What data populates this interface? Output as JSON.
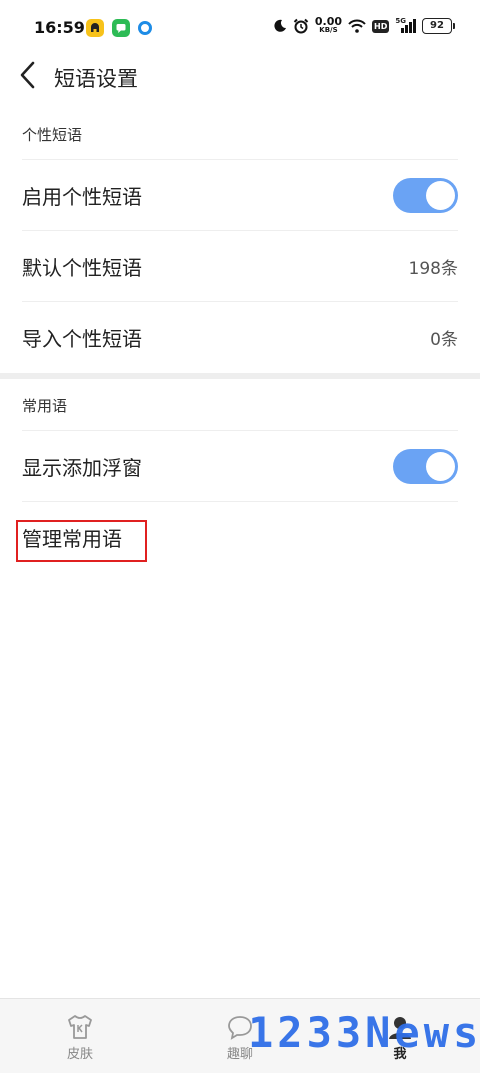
{
  "status_bar": {
    "time": "16:59",
    "net_speed_value": "0.00",
    "net_speed_unit": "KB/S",
    "hd_label": "HD",
    "network_label": "5G",
    "battery": "92",
    "notification_icons": [
      "yellow-app-icon",
      "green-chat-icon",
      "blue-circle-icon"
    ],
    "system_icons": [
      "moon-icon",
      "alarm-icon",
      "wifi-icon",
      "signal-icon",
      "battery-icon"
    ]
  },
  "header": {
    "back_icon": "chevron-left-icon",
    "title": "短语设置"
  },
  "sections": [
    {
      "title": "个性短语",
      "rows": [
        {
          "label": "启用个性短语",
          "type": "toggle",
          "on": true
        },
        {
          "label": "默认个性短语",
          "type": "value",
          "value": "198条"
        },
        {
          "label": "导入个性短语",
          "type": "value",
          "value": "0条"
        }
      ]
    },
    {
      "title": "常用语",
      "rows": [
        {
          "label": "显示添加浮窗",
          "type": "toggle",
          "on": true
        },
        {
          "label": "管理常用语",
          "type": "link"
        }
      ]
    }
  ],
  "bottom_nav": {
    "items": [
      {
        "label": "皮肤",
        "icon": "shirt-icon",
        "active": false
      },
      {
        "label": "趣聊",
        "icon": "chat-bubble-icon",
        "active": false
      },
      {
        "label": "我",
        "icon": "user-icon",
        "active": true
      }
    ]
  },
  "watermark": "1233News",
  "colors": {
    "toggle_on": "#6aa3f4",
    "highlight": "#e02020",
    "divider": "#eeeeee",
    "watermark": "#2f6fe8"
  }
}
